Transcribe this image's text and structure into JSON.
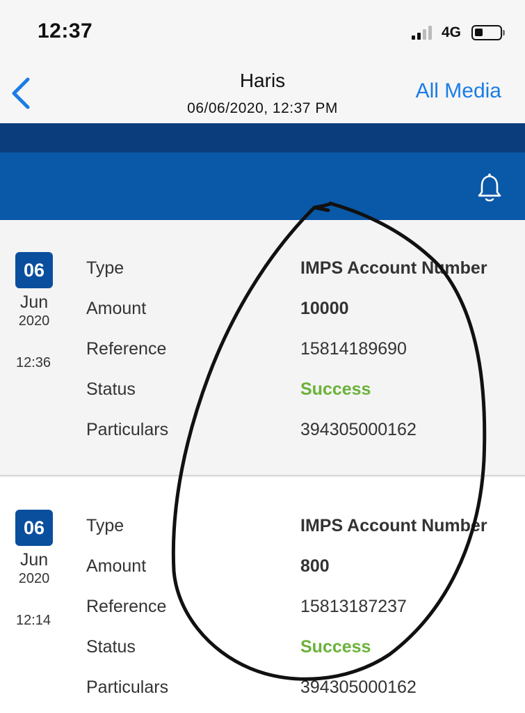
{
  "status_bar": {
    "time": "12:37",
    "network": "4G",
    "icons": [
      "signal-icon",
      "battery-icon"
    ]
  },
  "nav": {
    "title": "Haris",
    "subtitle": "06/06/2020, 12:37 PM",
    "right_action": "All Media",
    "back_icon": "chevron-left-icon",
    "accent_color": "#1b7ce6"
  },
  "app_header": {
    "bell_icon": "bell-icon",
    "colors": {
      "dark": "#0b3d7d",
      "primary": "#0a58a8"
    }
  },
  "transactions": [
    {
      "day": "06",
      "month": "Jun",
      "year": "2020",
      "time": "12:36",
      "rows": [
        {
          "label": "Type",
          "value": "IMPS Account Number"
        },
        {
          "label": "Amount",
          "value": "10000"
        },
        {
          "label": "Reference",
          "value": "15814189690"
        },
        {
          "label": "Status",
          "value": "Success"
        },
        {
          "label": "Particulars",
          "value": "394305000162"
        }
      ]
    },
    {
      "day": "06",
      "month": "Jun",
      "year": "2020",
      "time": "12:14",
      "rows": [
        {
          "label": "Type",
          "value": "IMPS Account Number"
        },
        {
          "label": "Amount",
          "value": "800"
        },
        {
          "label": "Reference",
          "value": "15813187237"
        },
        {
          "label": "Status",
          "value": "Success"
        },
        {
          "label": "Particulars",
          "value": "394305000162"
        }
      ]
    }
  ],
  "colors": {
    "success": "#6bb23a",
    "date_badge": "#0a4f9e"
  }
}
